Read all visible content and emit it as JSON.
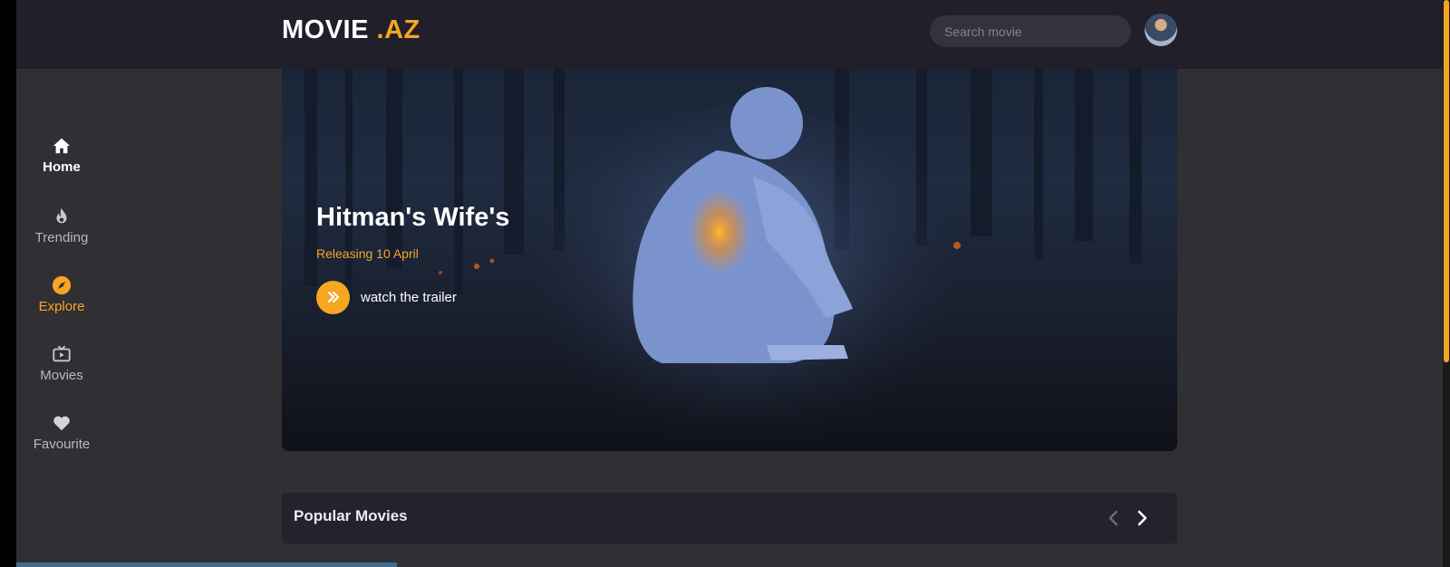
{
  "header": {
    "logo_main": "MOVIE",
    "logo_accent": " .AZ",
    "search_placeholder": "Search movie",
    "avatar_icon": "user-avatar"
  },
  "sidebar": {
    "items": [
      {
        "label": "Home",
        "icon": "home-icon",
        "state": "selected"
      },
      {
        "label": "Trending",
        "icon": "flame-icon"
      },
      {
        "label": "Explore",
        "icon": "compass-icon",
        "state": "active"
      },
      {
        "label": "Movies",
        "icon": "tv-icon"
      },
      {
        "label": "Favourite",
        "icon": "heart-icon"
      }
    ]
  },
  "hero": {
    "title": "Hitman's Wife's",
    "release": "Releasing 10 April",
    "trailer_label": "watch the trailer",
    "trailer_icon": "double-chevron-right-icon"
  },
  "popular": {
    "title": "Popular Movies",
    "prev_icon": "chevron-left-icon",
    "next_icon": "chevron-right-icon"
  },
  "colors": {
    "accent": "#f5a623",
    "topbar": "#201f2a",
    "background": "#302f33",
    "panel": "#23222d"
  }
}
